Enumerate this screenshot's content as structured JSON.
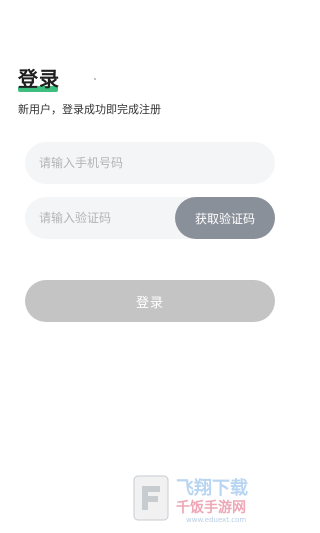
{
  "header": {
    "title": "登录",
    "subtitle": "新用户，登录成功即完成注册"
  },
  "form": {
    "phone_placeholder": "请输入手机号码",
    "phone_value": "",
    "code_placeholder": "请输入验证码",
    "code_value": "",
    "get_code_label": "获取验证码",
    "login_label": "登录"
  },
  "watermark": {
    "line1": "飞翔下载",
    "line2": "千饭手游网",
    "url": "www.eduext.com"
  },
  "colors": {
    "accent": "#3fbf7f",
    "field_bg": "#f4f5f7",
    "get_code_bg": "#8a9099",
    "login_bg": "#c4c4c4"
  }
}
